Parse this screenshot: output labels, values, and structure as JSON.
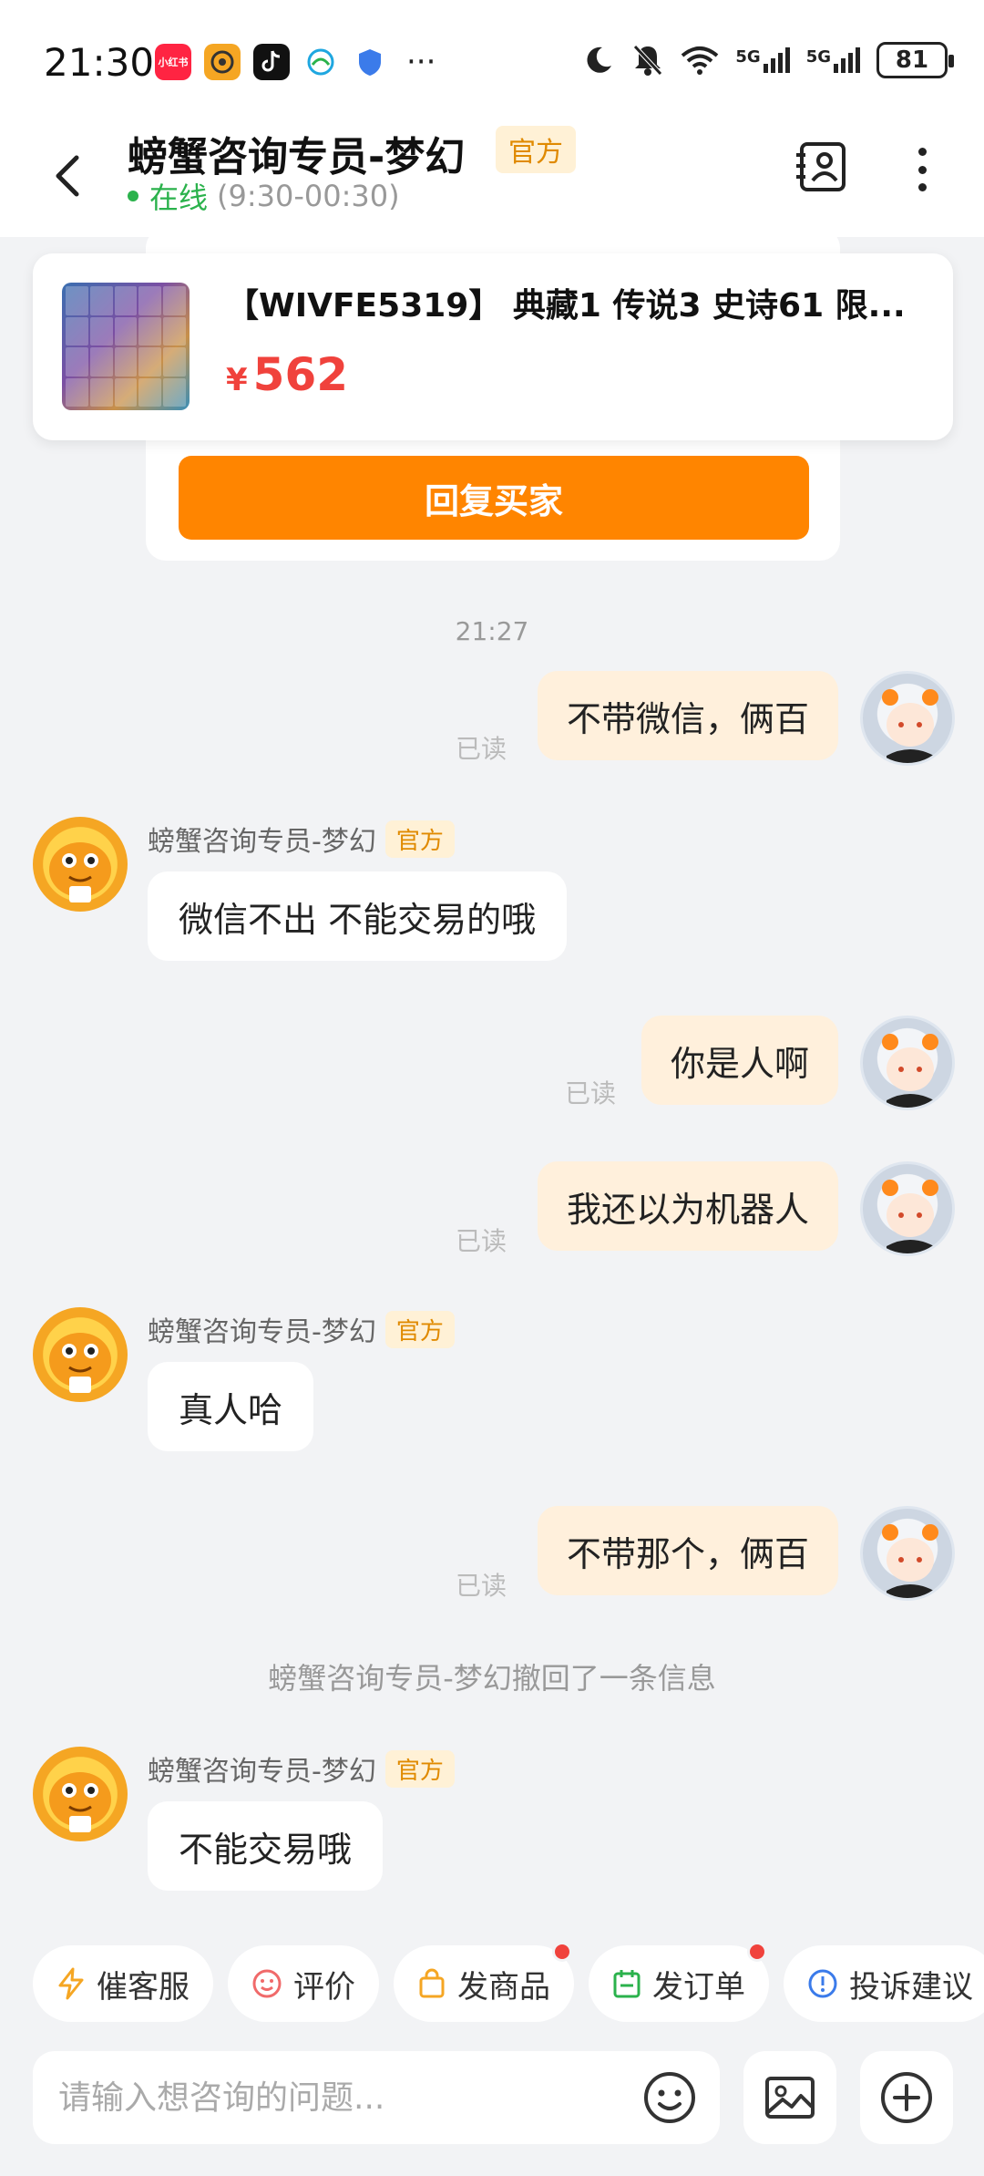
{
  "status_bar": {
    "time": "21:30",
    "apps": [
      {
        "icon": "xiaohongshu-icon",
        "label": "小红书",
        "color": "#ff2442"
      },
      {
        "icon": "app-orange-icon",
        "label": "",
        "color": "#f5a623"
      },
      {
        "icon": "tiktok-icon",
        "label": "",
        "color": "#111111"
      },
      {
        "icon": "mobile-carrier-icon",
        "label": "",
        "color": "#1fa7e0"
      },
      {
        "icon": "shield-icon",
        "label": "",
        "color": "#3b7bea"
      }
    ],
    "network_1": "5G",
    "network_2": "5G",
    "battery": "81"
  },
  "header": {
    "title": "螃蟹咨询专员-梦幻",
    "badge": "官方",
    "status": "在线",
    "hours": "(9:30-00:30)"
  },
  "product": {
    "title": "【WIVFE5319】 典藏1 传说3 史诗61 限...",
    "currency": "¥",
    "price": "562"
  },
  "reply_button": "回复买家",
  "chat": {
    "timestamp": "21:27",
    "read_label": "已读",
    "agent_name": "螃蟹咨询专员-梦幻",
    "agent_badge": "官方",
    "messages": [
      {
        "from": "me",
        "text": "不带微信，俩百"
      },
      {
        "from": "agent",
        "text": "微信不出  不能交易的哦"
      },
      {
        "from": "me",
        "text": "你是人啊"
      },
      {
        "from": "me",
        "text": "我还以为机器人"
      },
      {
        "from": "agent",
        "text": "真人哈"
      },
      {
        "from": "me",
        "text": "不带那个，俩百"
      },
      {
        "from": "agent",
        "text": "不能交易哦"
      }
    ],
    "recall_notice": "螃蟹咨询专员-梦幻撤回了一条信息"
  },
  "quick_actions": [
    {
      "label": "催客服",
      "icon": "lightning-icon",
      "dot": false
    },
    {
      "label": "评价",
      "icon": "smile-icon",
      "dot": false
    },
    {
      "label": "发商品",
      "icon": "bag-icon",
      "dot": true
    },
    {
      "label": "发订单",
      "icon": "order-icon",
      "dot": true
    },
    {
      "label": "投诉建议",
      "icon": "info-icon",
      "dot": false
    }
  ],
  "input": {
    "placeholder": "请输入想咨询的问题..."
  },
  "colors": {
    "accent_orange": "#ff8500",
    "price_red": "#f0423c",
    "online_green": "#2bb24c",
    "my_bubble": "#fff0dc"
  }
}
